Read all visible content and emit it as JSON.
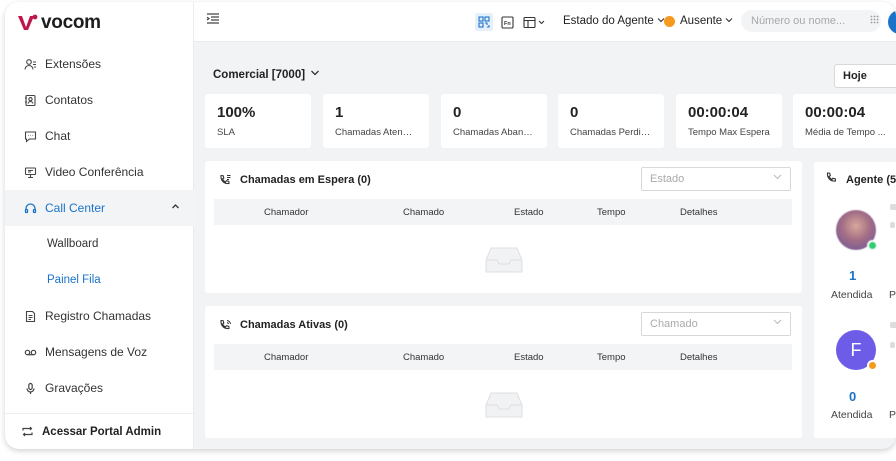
{
  "brand": {
    "name": "vocom",
    "accent": "#1a73c8",
    "logo_color": "#c0174a"
  },
  "sidebar": {
    "items": [
      {
        "label": "Extensões",
        "icon": "users-icon"
      },
      {
        "label": "Contatos",
        "icon": "contacts-icon"
      },
      {
        "label": "Chat",
        "icon": "chat-icon"
      },
      {
        "label": "Video Conferência",
        "icon": "monitor-icon"
      },
      {
        "label": "Call Center",
        "icon": "headset-icon",
        "active": true,
        "children": [
          {
            "label": "Wallboard"
          },
          {
            "label": "Painel Fila",
            "selected": true
          }
        ]
      },
      {
        "label": "Registro Chamadas",
        "icon": "log-icon"
      },
      {
        "label": "Mensagens de Voz",
        "icon": "voicemail-icon"
      },
      {
        "label": "Gravações",
        "icon": "microphone-icon"
      }
    ],
    "portal_label": "Acessar Portal Admin"
  },
  "topbar": {
    "agent_state_label": "Estado do Agente",
    "status_label": "Ausente",
    "status_color": "#f59a1c",
    "search_placeholder": "Número ou nome..."
  },
  "main": {
    "queue_label": "Comercial [7000]",
    "period_label": "Hoje",
    "stats": [
      {
        "value": "100%",
        "label": "SLA"
      },
      {
        "value": "1",
        "label": "Chamadas Atendi..."
      },
      {
        "value": "0",
        "label": "Chamadas Aband..."
      },
      {
        "value": "0",
        "label": "Chamadas Perdid..."
      },
      {
        "value": "00:00:04",
        "label": "Tempo Max Espera"
      },
      {
        "value": "00:00:04",
        "label": "Média de Tempo ..."
      }
    ],
    "waiting_panel": {
      "title": "Chamadas em Espera (0)",
      "filter_placeholder": "Estado",
      "columns": [
        "Chamador",
        "Chamado",
        "Estado",
        "Tempo",
        "Detalhes"
      ]
    },
    "active_panel": {
      "title": "Chamadas Ativas (0)",
      "filter_placeholder": "Chamado",
      "columns": [
        "Chamador",
        "Chamado",
        "Estado",
        "Tempo",
        "Detalhes"
      ]
    },
    "agents_panel": {
      "title": "Agente (5",
      "agents": [
        {
          "initial": "",
          "count": "1",
          "count_label": "Atendida",
          "extra_label": "P",
          "status_color": "#2ecc71"
        },
        {
          "initial": "F",
          "count": "0",
          "count_label": "Atendida",
          "extra_label": "P",
          "status_color": "#f59a1c"
        }
      ]
    }
  }
}
